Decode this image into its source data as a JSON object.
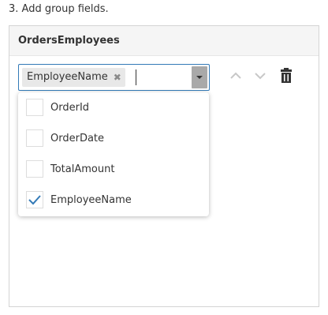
{
  "step_title": "3. Add group fields.",
  "panel": {
    "title": "OrdersEmployees"
  },
  "tagbox": {
    "tags": [
      {
        "label": "EmployeeName",
        "remove_glyph": "✖"
      }
    ],
    "dropdown_icon": "chevron-down-icon"
  },
  "controls": {
    "move_up_icon": "chevron-up-icon",
    "move_down_icon": "chevron-down-icon",
    "delete_icon": "trash-icon"
  },
  "dropdown": {
    "items": [
      {
        "label": "OrderId",
        "checked": false
      },
      {
        "label": "OrderDate",
        "checked": false
      },
      {
        "label": "TotalAmount",
        "checked": false
      },
      {
        "label": "EmployeeName",
        "checked": true
      }
    ]
  },
  "colors": {
    "accent": "#337ab7",
    "tag_background": "#e8e8e8",
    "icon_dark": "#333333",
    "icon_disabled": "#c8c8c8"
  }
}
